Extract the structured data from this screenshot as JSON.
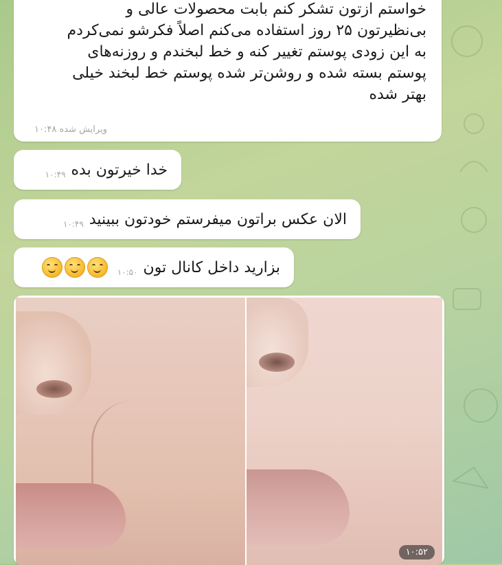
{
  "messages": [
    {
      "lines": [
        "خواستم ازتون تشکر کنم بابت محصولات عالی و",
        "بی‌نظیرتون ۲۵ روز استفاده می‌کنم اصلاً فکرشو نمی‌کردم",
        "به این زودی پوستم تغییر کنه و خط لبخندم و روزنه‌های",
        "پوستم بسته  شده و روشن‌تر شده پوستم خط لبخند خیلی",
        "بهتر شده"
      ],
      "time": "۱۰:۴۸",
      "edited": "ویرایش شده"
    },
    {
      "text": "خدا خیرتون بده",
      "time": "۱۰:۴۹"
    },
    {
      "text": "الان عکس براتون میفرستم خودتون ببینید",
      "time": "۱۰:۴۹"
    },
    {
      "text": "بزارید داخل کانال تون",
      "time": "۱۰:۵۰",
      "emoji": [
        "smiling-face-icon",
        "smiling-face-icon",
        "smiling-face-icon"
      ]
    }
  ],
  "photo": {
    "time": "۱۰:۵۲"
  }
}
